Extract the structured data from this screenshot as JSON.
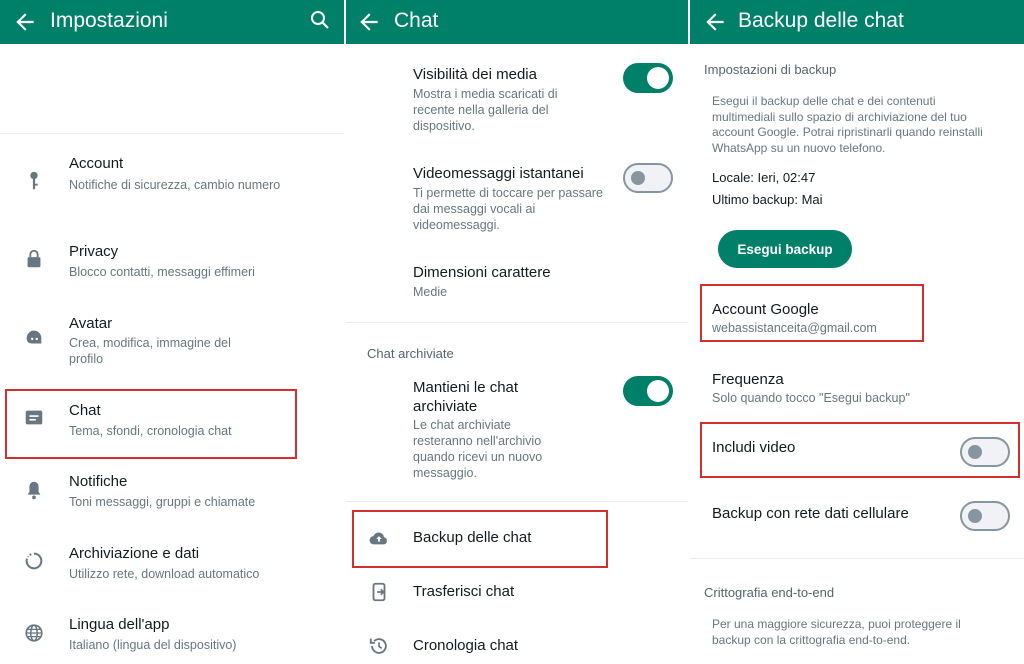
{
  "settings": {
    "title": "Impostazioni",
    "items": [
      {
        "title": "Account",
        "sub": "Notifiche di sicurezza, cambio numero"
      },
      {
        "title": "Privacy",
        "sub": "Blocco contatti, messaggi effimeri"
      },
      {
        "title": "Avatar",
        "sub": "Crea, modifica, immagine del profilo"
      },
      {
        "title": "Chat",
        "sub": "Tema, sfondi, cronologia chat"
      },
      {
        "title": "Notifiche",
        "sub": "Toni messaggi, gruppi e chiamate"
      },
      {
        "title": "Archiviazione e dati",
        "sub": "Utilizzo rete, download automatico"
      },
      {
        "title": "Lingua dell'app",
        "sub": "Italiano (lingua del dispositivo)"
      }
    ]
  },
  "chat": {
    "title": "Chat",
    "media_visibility": {
      "title": "Visibilità dei media",
      "sub": "Mostra i media scaricati di recente nella galleria del dispositivo.",
      "enabled": true
    },
    "instant_video": {
      "title": "Videomessaggi istantanei",
      "sub": "Ti permette di toccare per passare dai messaggi vocali ai videomessaggi.",
      "enabled": false
    },
    "font_size": {
      "title": "Dimensioni carattere",
      "value": "Medie"
    },
    "archived_section": "Chat archiviate",
    "keep_archived": {
      "title": "Mantieni le chat archiviate",
      "sub": "Le chat archiviate resteranno nell'archivio quando ricevi un nuovo messaggio.",
      "enabled": true
    },
    "links": [
      {
        "label": "Backup delle chat"
      },
      {
        "label": "Trasferisci chat"
      },
      {
        "label": "Cronologia chat"
      }
    ]
  },
  "backup": {
    "title": "Backup delle chat",
    "section": "Impostazioni di backup",
    "description": "Esegui il backup delle chat e dei contenuti multimediali sullo spazio di archiviazione del tuo account Google. Potrai ripristinarli quando reinstalli WhatsApp su un nuovo telefono.",
    "local": "Locale: Ieri, 02:47",
    "last_backup": "Ultimo backup: Mai",
    "button": "Esegui backup",
    "google_account": {
      "title": "Account Google",
      "value": "webassistanceita@gmail.com"
    },
    "frequency": {
      "title": "Frequenza",
      "value": "Solo quando tocco \"Esegui backup\""
    },
    "include_video": {
      "title": "Includi video",
      "enabled": false
    },
    "cellular": {
      "title": "Backup con rete dati cellulare",
      "enabled": false
    },
    "e2e_section": "Crittografia end-to-end",
    "e2e_text": "Per una maggiore sicurezza, puoi proteggere il backup con la crittografia end-to-end."
  },
  "colors": {
    "brand": "#008069",
    "highlight": "#d32f2f"
  }
}
